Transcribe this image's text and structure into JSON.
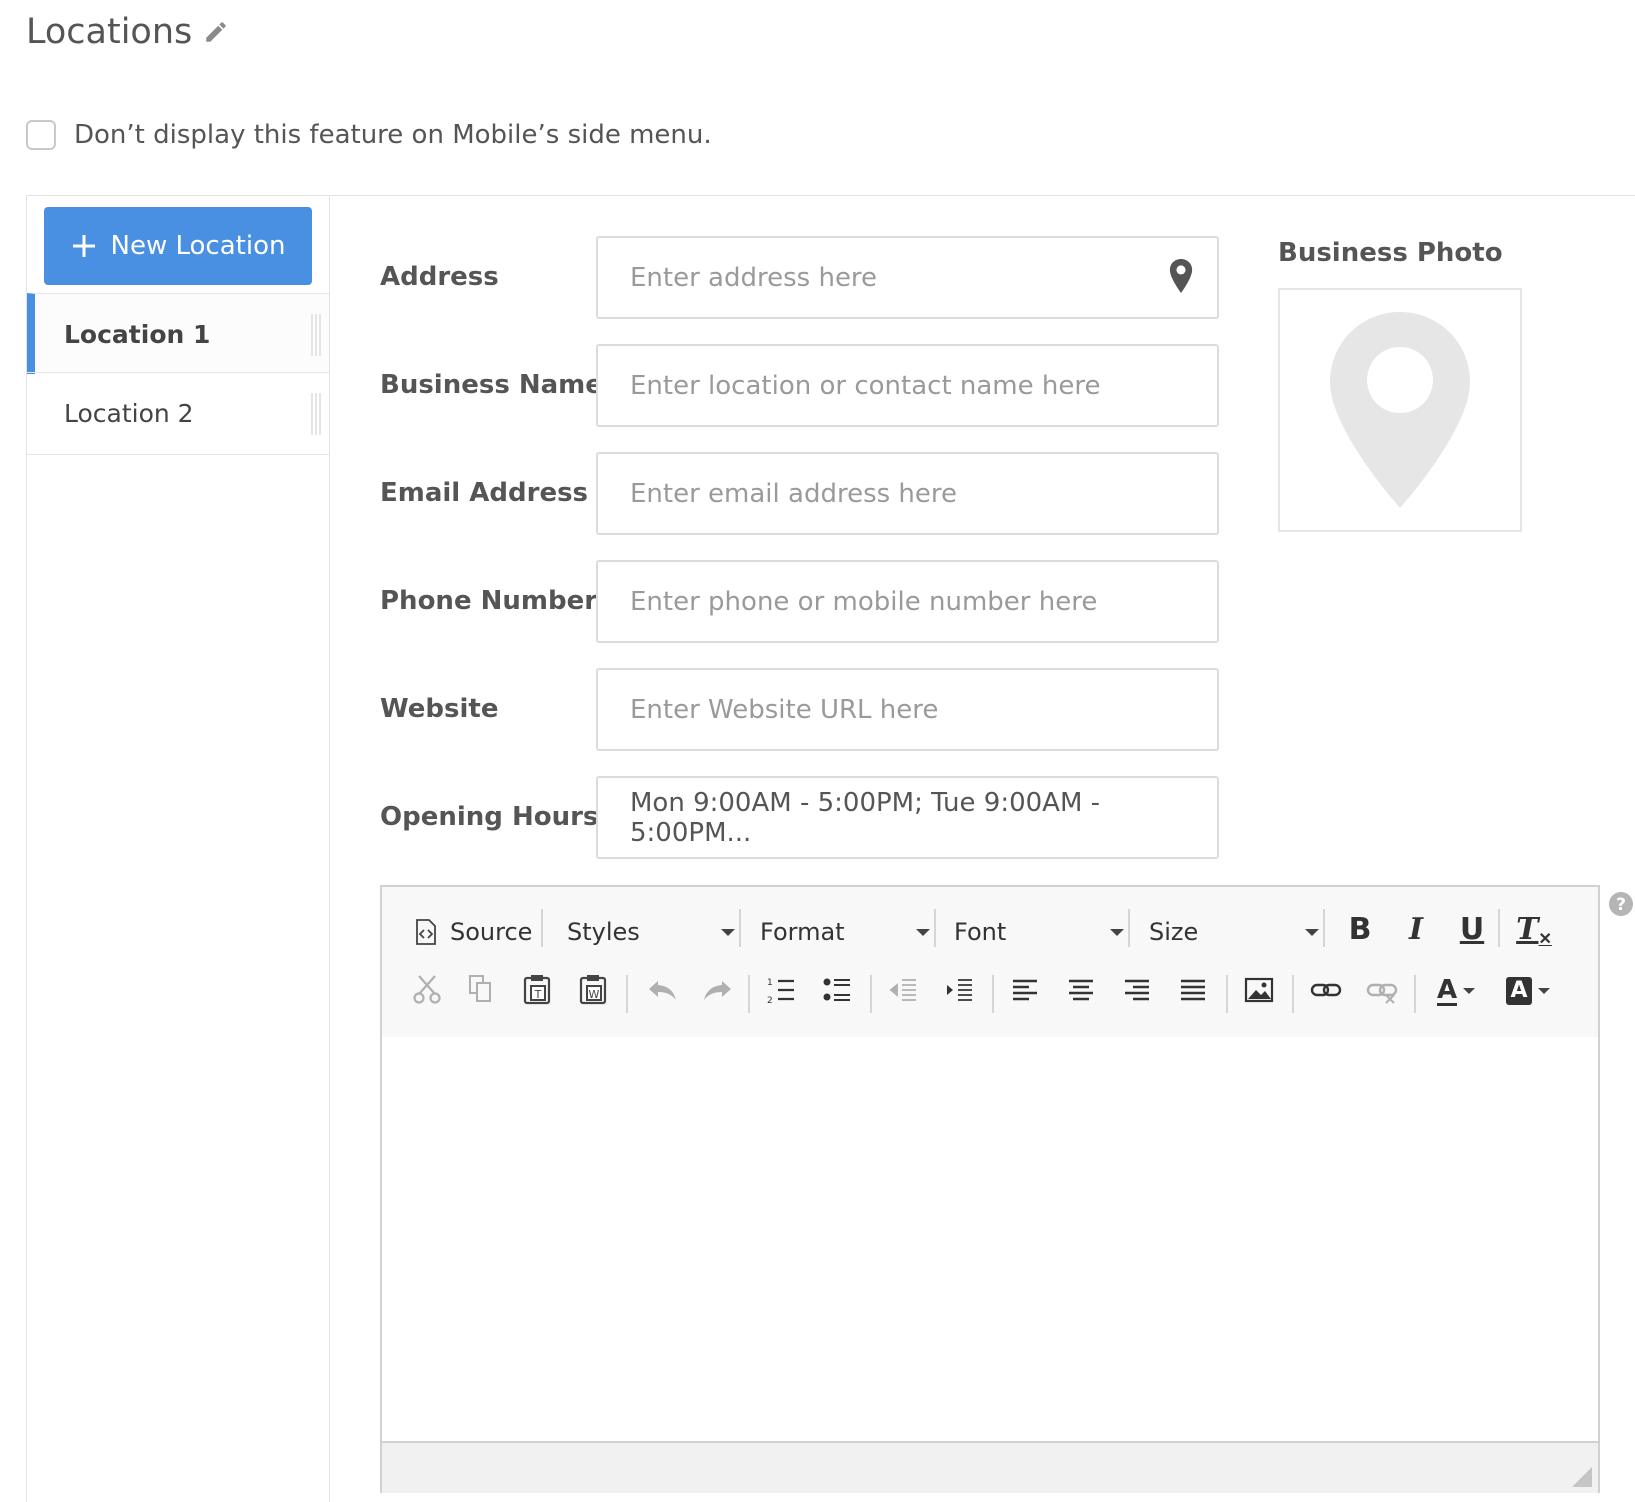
{
  "page": {
    "title": "Locations"
  },
  "mobile_option": {
    "label": "Don’t display this feature on Mobile’s side menu.",
    "checked": false
  },
  "sidebar": {
    "new_button_label": "New Location",
    "locations": [
      {
        "label": "Location 1",
        "active": true
      },
      {
        "label": "Location 2",
        "active": false
      }
    ]
  },
  "form": {
    "address": {
      "label": "Address",
      "placeholder": "Enter address here"
    },
    "business_name": {
      "label": "Business Name",
      "placeholder": "Enter location or contact name here"
    },
    "email": {
      "label": "Email Address",
      "placeholder": "Enter email address here"
    },
    "phone": {
      "label": "Phone Number",
      "placeholder": "Enter phone or mobile number here"
    },
    "website": {
      "label": "Website",
      "placeholder": "Enter Website URL here"
    },
    "opening_hours": {
      "label": "Opening Hours",
      "value": "Mon 9:00AM - 5:00PM; Tue 9:00AM - 5:00PM..."
    }
  },
  "photo": {
    "label": "Business Photo",
    "icon": "map-pin-icon"
  },
  "editor": {
    "source_label": "Source",
    "styles_label": "Styles",
    "format_label": "Format",
    "font_label": "Font",
    "size_label": "Size",
    "bold_glyph": "B",
    "italic_glyph": "I",
    "underline_glyph": "U",
    "remove_format_glyph": "T",
    "text_color_glyph": "A",
    "bg_color_glyph": "A"
  },
  "colors": {
    "accent": "#4a90e2",
    "text": "#555555",
    "border": "#dcdcdc",
    "pin": "#e6e6e6"
  }
}
